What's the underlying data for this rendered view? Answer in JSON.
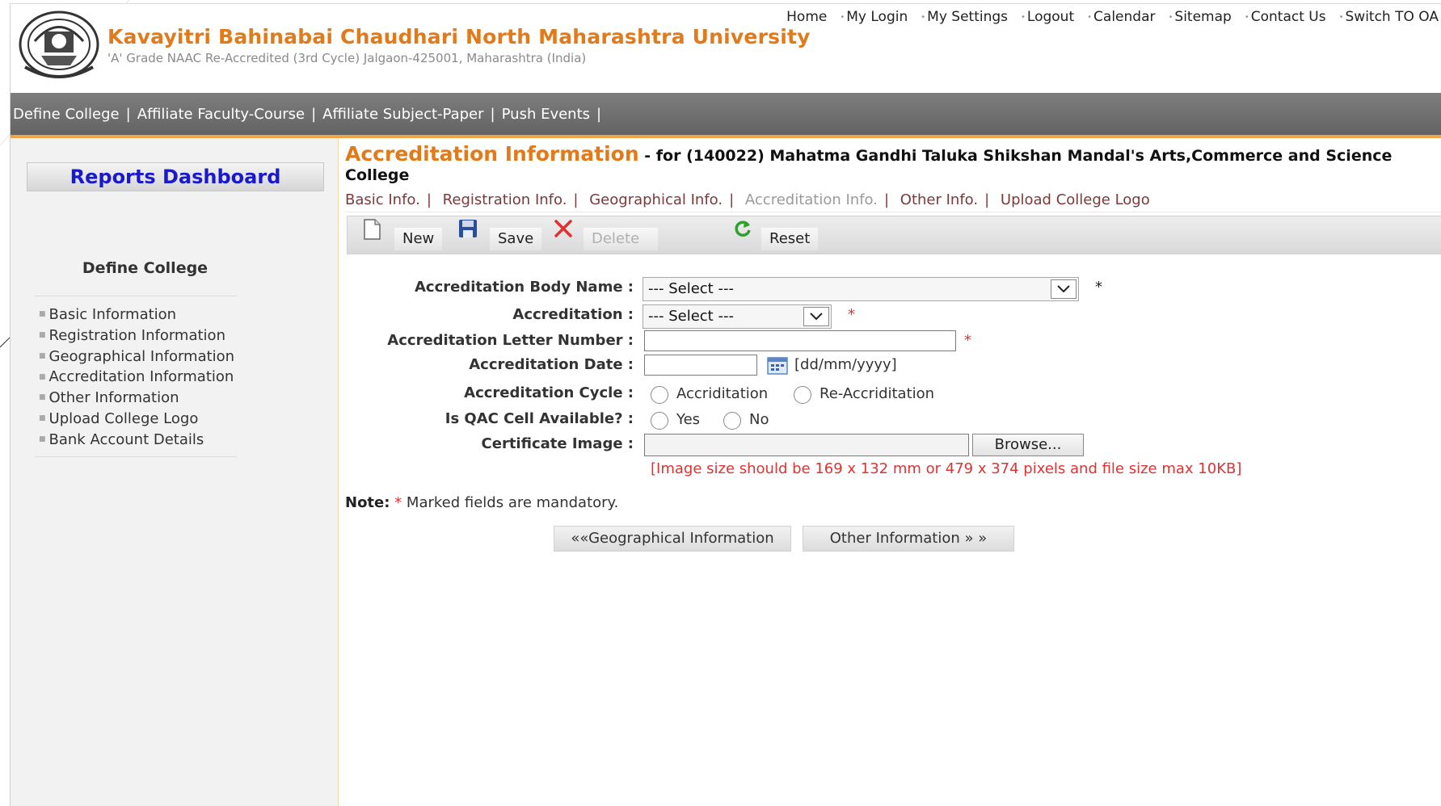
{
  "header": {
    "university_name": "Kavayitri Bahinabai Chaudhari North Maharashtra University",
    "subtitle": "'A' Grade NAAC Re-Accredited (3rd Cycle) Jalgaon-425001, Maharashtra (India)",
    "top_links": [
      "Home",
      "My Login",
      "My Settings",
      "Logout",
      "Calendar",
      "Sitemap",
      "Contact Us",
      "Switch TO OA"
    ]
  },
  "menu": {
    "items": [
      "Define College",
      "Affiliate Faculty-Course",
      "Affiliate Subject-Paper",
      "Push Events"
    ],
    "separator": "|"
  },
  "sidebar": {
    "dashboard_label": "Reports Dashboard",
    "section_title": "Define College",
    "items": [
      "Basic Information",
      "Registration Information",
      "Geographical Information",
      "Accreditation Information",
      "Other Information",
      "Upload College Logo",
      "Bank Account Details"
    ]
  },
  "main": {
    "title_accent": "Accreditation Information",
    "title_rest": " - for (140022) Mahatma Gandhi Taluka Shikshan Mandal's Arts,Commerce and Science College",
    "tabs": [
      "Basic Info.",
      "Registration Info.",
      "Geographical Info.",
      "Accreditation Info.",
      "Other Info.",
      "Upload College Logo"
    ],
    "active_tab": "Accreditation Info.",
    "toolbar": {
      "new": "New",
      "save": "Save",
      "delete": "Delete",
      "reset": "Reset"
    },
    "form": {
      "body_name_label": "Accreditation Body Name :",
      "body_name_value": "--- Select ---",
      "accreditation_label": "Accreditation :",
      "accreditation_value": "--- Select ---",
      "letter_number_label": "Accreditation Letter Number :",
      "letter_number_value": "",
      "date_label": "Accreditation Date :",
      "date_value": "",
      "date_format": "[dd/mm/yyyy]",
      "cycle_label": "Accreditation Cycle :",
      "cycle_options": [
        "Accriditation",
        "Re-Accriditation"
      ],
      "qac_label": "Is QAC Cell Available? :",
      "qac_options": [
        "Yes",
        "No"
      ],
      "certificate_label": "Certificate Image :",
      "browse_label": "Browse...",
      "image_hint": "[Image size should be 169 x 132 mm or 479 x 374 pixels and file size max 10KB]",
      "required_mark": "*"
    },
    "note_label": "Note:",
    "note_text": " Marked fields are mandatory.",
    "prev_button": "««Geographical Information",
    "next_button": "Other Information » »"
  },
  "colors": {
    "accent_orange": "#e07a1a",
    "link_blue": "#1a1acc",
    "required_red": "#dd3333",
    "menu_gray": "#6e6e6e"
  }
}
